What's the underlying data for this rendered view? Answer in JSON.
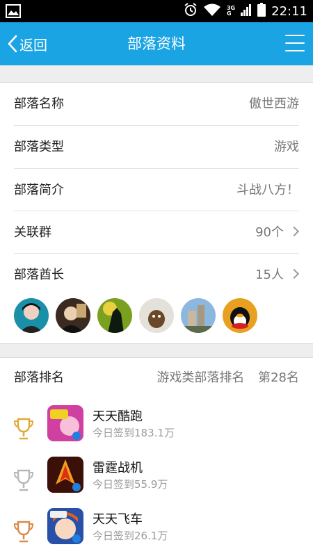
{
  "status_bar": {
    "time": "22:11",
    "network_top": "3G",
    "network_bottom": "G"
  },
  "nav": {
    "back_label": "返回",
    "title": "部落资料"
  },
  "info": {
    "rows": [
      {
        "label": "部落名称",
        "value": "傲世西游"
      },
      {
        "label": "部落类型",
        "value": "游戏"
      },
      {
        "label": "部落简介",
        "value": "斗战八方！"
      },
      {
        "label": "关联群",
        "value": "90个"
      },
      {
        "label": "部落酋长",
        "value": "15人"
      }
    ]
  },
  "ranking": {
    "label": "部落排名",
    "category": "游戏类部落排名",
    "rank": "第28名",
    "games": [
      {
        "name": "天天酷跑",
        "stat": "今日签到183.1万",
        "trophy_color": "#e0a93a"
      },
      {
        "name": "雷霆战机",
        "stat": "今日签到55.9万",
        "trophy_color": "#b8b8b8"
      },
      {
        "name": "天天飞车",
        "stat": "今日签到26.1万",
        "trophy_color": "#d88a4a"
      }
    ]
  },
  "colors": {
    "accent": "#1aa4e4"
  }
}
